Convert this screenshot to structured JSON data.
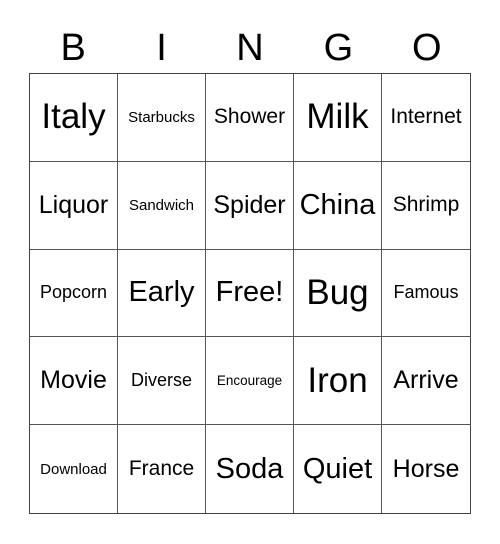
{
  "header": {
    "letters": [
      "B",
      "I",
      "N",
      "G",
      "O"
    ]
  },
  "board": {
    "rows": [
      [
        "Italy",
        "Starbucks",
        "Shower",
        "Milk",
        "Internet"
      ],
      [
        "Liquor",
        "Sandwich",
        "Spider",
        "China",
        "Shrimp"
      ],
      [
        "Popcorn",
        "Early",
        "Free!",
        "Bug",
        "Famous"
      ],
      [
        "Movie",
        "Diverse",
        "Encourage",
        "Iron",
        "Arrive"
      ],
      [
        "Download",
        "France",
        "Soda",
        "Quiet",
        "Horse"
      ]
    ]
  }
}
